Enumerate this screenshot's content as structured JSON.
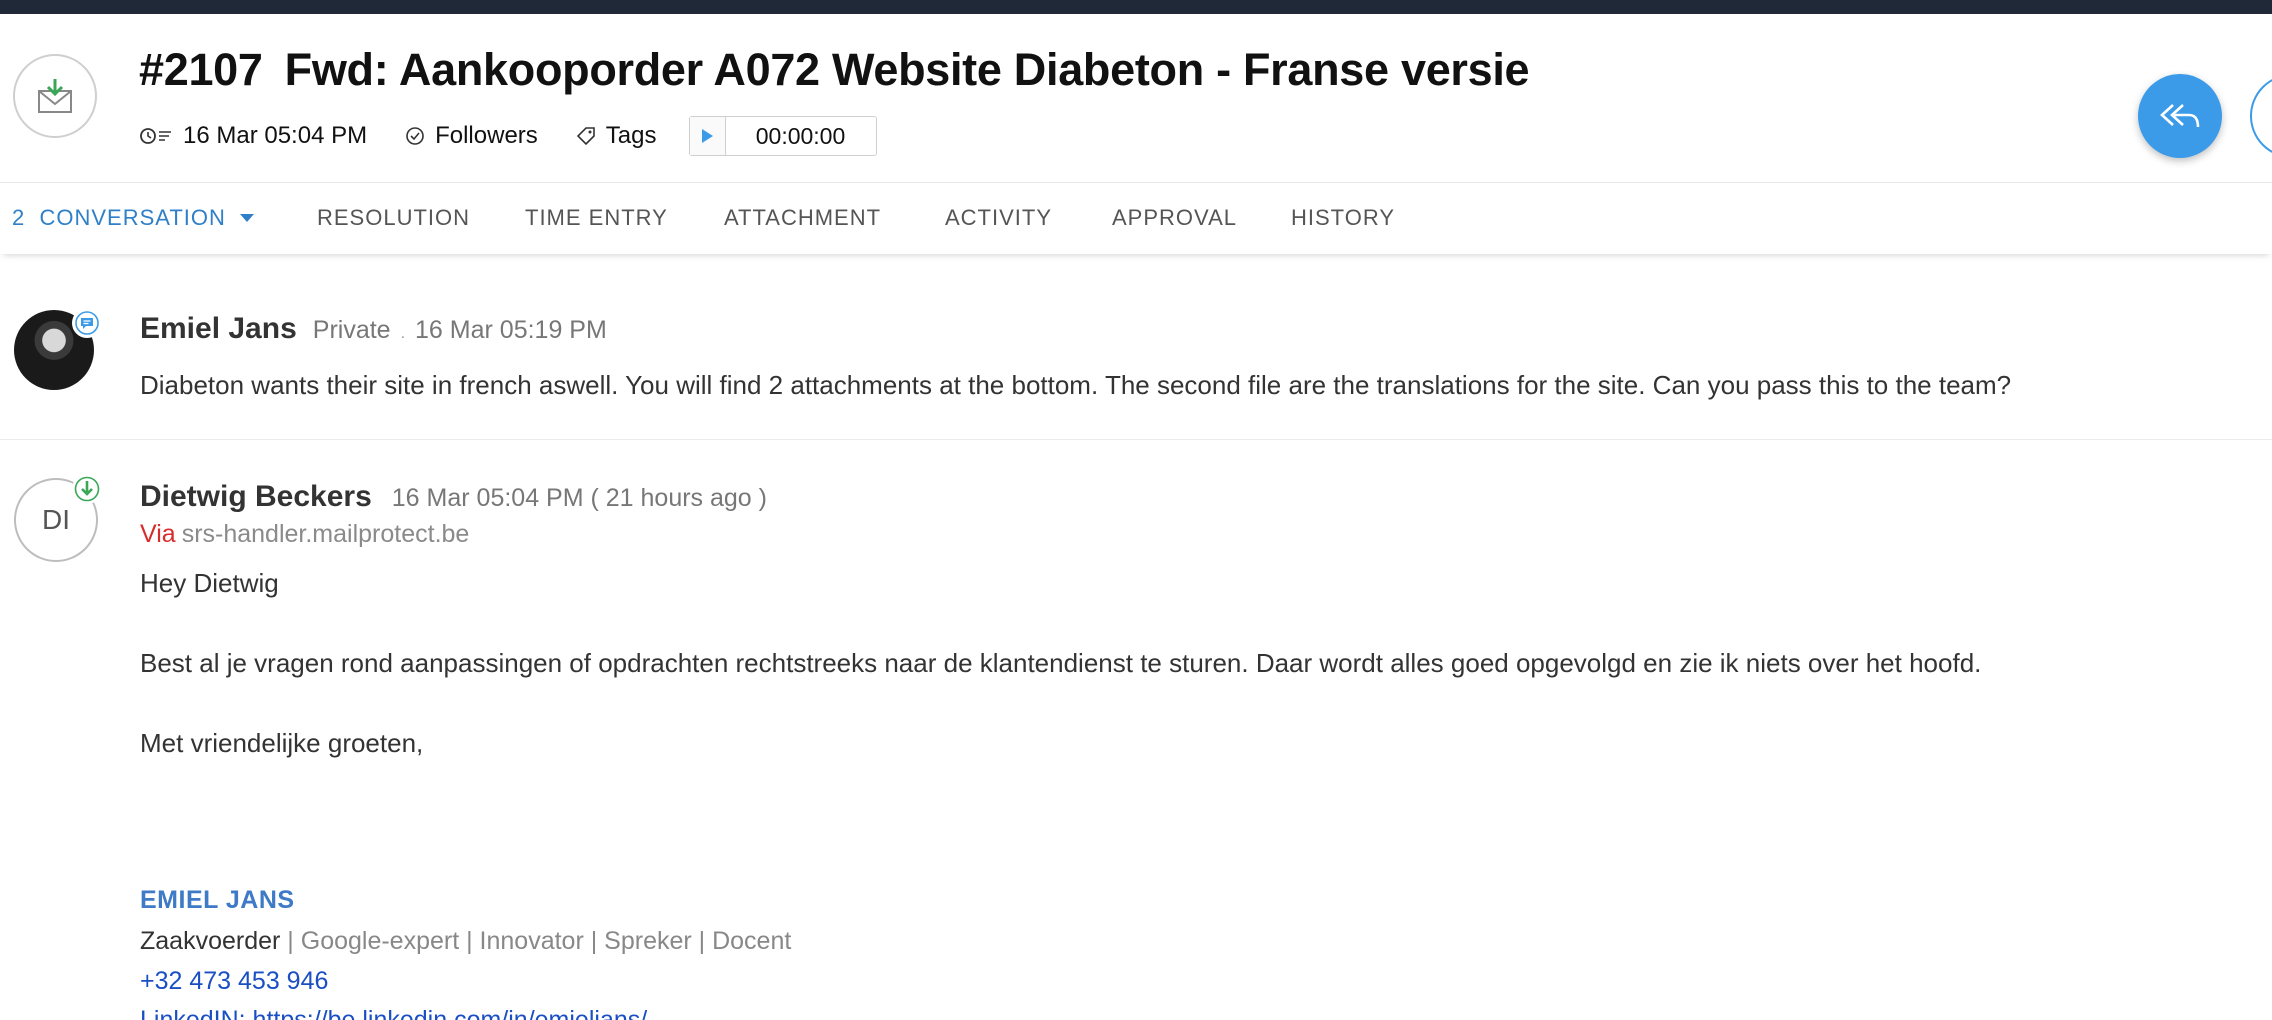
{
  "header": {
    "ticket_number": "#2107",
    "title": "Fwd: Aankooporder A072 Website Diabeton - Franse versie",
    "created_time": "16 Mar 05:04 PM",
    "followers_label": "Followers",
    "tags_label": "Tags",
    "timer_value": "00:00:00"
  },
  "tabs": {
    "conversation_count": "2",
    "conversation": "CONVERSATION",
    "resolution": "RESOLUTION",
    "time_entry": "TIME ENTRY",
    "attachment": "ATTACHMENT",
    "activity": "ACTIVITY",
    "approval": "APPROVAL",
    "history": "HISTORY"
  },
  "messages": [
    {
      "author": "Emiel Jans",
      "visibility": "Private",
      "separator": ".",
      "timestamp": "16 Mar 05:19 PM",
      "body": "Diabeton wants their site in french aswell. You will find 2 attachments at the bottom. The second file are the translations for the site. Can you pass this to the team?"
    },
    {
      "author": "Dietwig Beckers",
      "initials": "DI",
      "timestamp": "16 Mar 05:04 PM ( 21 hours ago )",
      "via_label": "Via",
      "via_host": "srs-handler.mailprotect.be",
      "greeting": "Hey Dietwig",
      "paragraph": "Best al je vragen rond aanpassingen of opdrachten rechtstreeks naar de klantendienst te sturen. Daar wordt alles goed opgevolgd en zie ik niets over het hoofd.",
      "closing": "Met vriendelijke groeten,",
      "signature": {
        "name": "EMIEL JANS",
        "role_primary": "Zaakvoerder",
        "role_rest": " | Google-expert | Innovator | Spreker | Docent",
        "phone": "+32 473 453 946",
        "linkedin": "LinkedIN: https://be.linkedin.com/in/emieljans/"
      }
    }
  ],
  "colors": {
    "accent": "#3b9be8",
    "active_tab": "#2f80c8",
    "via_red": "#d92b2b",
    "signature_blue": "#3f7ac7",
    "link_blue": "#1a4fc4"
  },
  "icons": {
    "request_type": "email-incoming-icon",
    "time": "clock-icon",
    "followers": "check-circle-icon",
    "tags": "tag-icon",
    "timer": "play-icon",
    "reply_all": "reply-all-icon",
    "private_note": "chat-bubble-icon",
    "incoming": "incoming-arrow-icon"
  }
}
